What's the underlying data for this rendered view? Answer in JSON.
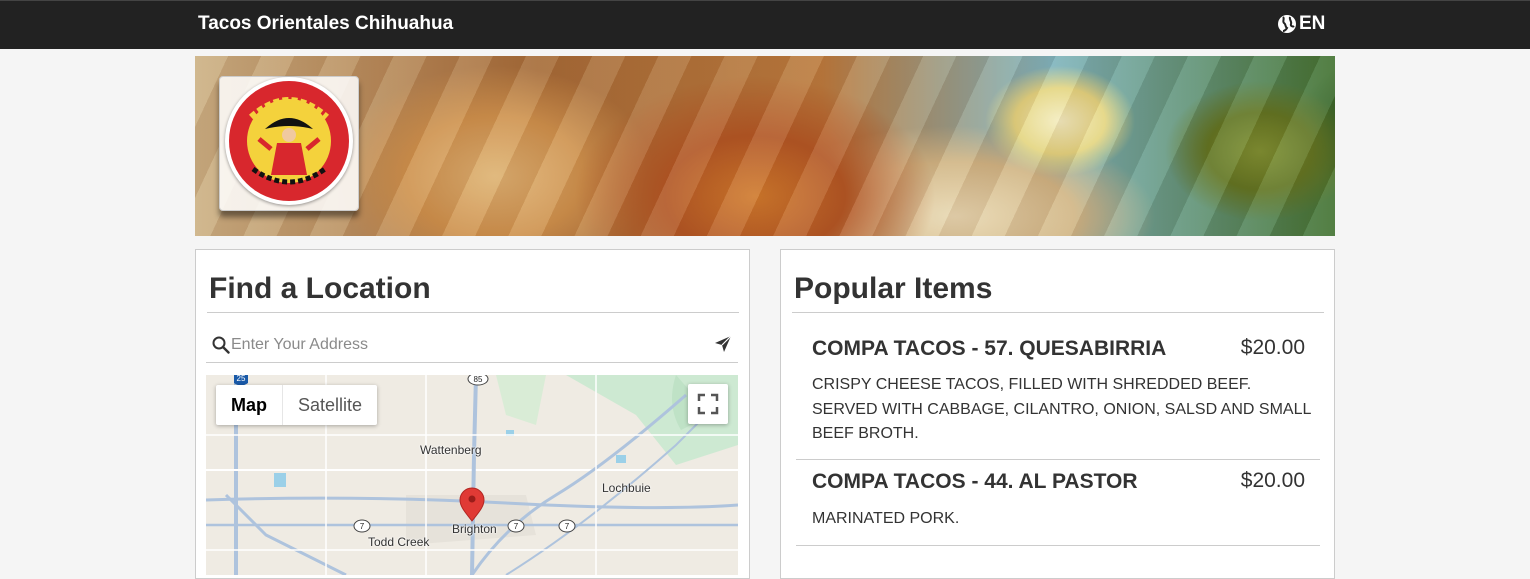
{
  "header": {
    "brand": "Tacos Orientales Chihuahua",
    "lang": "EN",
    "lang_icon": "globe-icon"
  },
  "hero": {
    "logo_alt": "Tacos Orientales Chihuahua logo"
  },
  "find_location": {
    "title": "Find a Location",
    "search_placeholder": "Enter Your Address",
    "map": {
      "map_tab": "Map",
      "satellite_tab": "Satellite",
      "labels": {
        "wattenberg": "Wattenberg",
        "lochbuie": "Lochbuie",
        "brighton": "Brighton",
        "todd_creek": "Todd Creek"
      },
      "shields": {
        "i25": "25",
        "us85": "85",
        "r7a": "7",
        "r7b": "7",
        "r7c": "7"
      }
    }
  },
  "popular": {
    "title": "Popular Items",
    "items": [
      {
        "name": "COMPA TACOS - 57. QUESABIRRIA",
        "price": "$20.00",
        "desc": "CRISPY CHEESE TACOS, FILLED WITH SHREDDED BEEF. SERVED WITH CABBAGE, CILANTRO, ONION, SALSD AND SMALL BEEF BROTH."
      },
      {
        "name": "COMPA TACOS - 44. AL PASTOR",
        "price": "$20.00",
        "desc": "MARINATED PORK."
      }
    ]
  },
  "colors": {
    "topbar": "#222222",
    "pin": "#e03a35",
    "accent_text": "#333333"
  }
}
